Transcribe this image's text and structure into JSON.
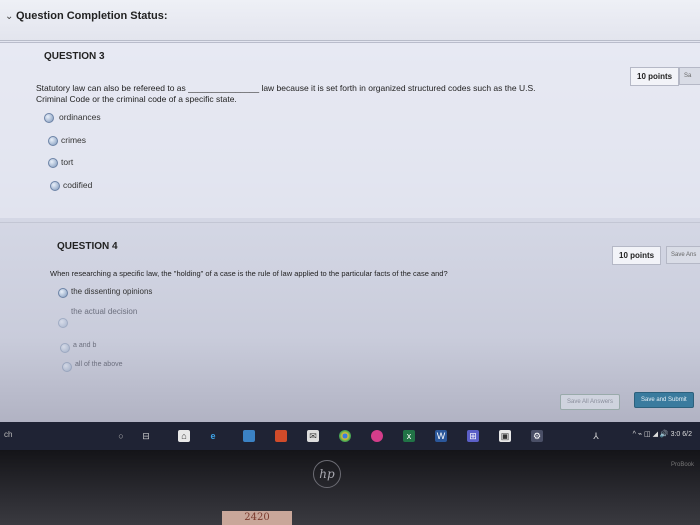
{
  "status_bar": {
    "title": "Question Completion Status:"
  },
  "question3": {
    "heading": "QUESTION 3",
    "points": "10 points",
    "save_tab": "Sa",
    "text_line1_before": "Statutory law can also be refereed to as ",
    "blank": "_______________",
    "text_line1_after": " law because it is set forth in organized structured codes such as the U.S.",
    "text_line2": "Criminal Code or the criminal code of a specific state.",
    "options": [
      "ordinances",
      "crimes",
      "tort",
      "codified"
    ]
  },
  "question4": {
    "heading": "QUESTION 4",
    "points": "10 points",
    "save_tab": "Save Ans",
    "text": "When researching a specific law, the \"holding\" of a case is the rule of law applied to the particular facts of the case and?",
    "options": [
      "the dissenting opinions",
      "the actual decision",
      "a and b",
      "all of the above"
    ]
  },
  "footer": {
    "save_all": "Save All Answers",
    "save_submit": "Save and Submit"
  },
  "taskbar": {
    "search_stub": "ch",
    "tray_time": "3:0",
    "tray_date": "6/2"
  },
  "laptop": {
    "brand": "hp",
    "model": "ProBook",
    "sticky_note": "2420"
  },
  "colors": {
    "submit": "#3a7b9e",
    "radio": "#7f98bb"
  }
}
